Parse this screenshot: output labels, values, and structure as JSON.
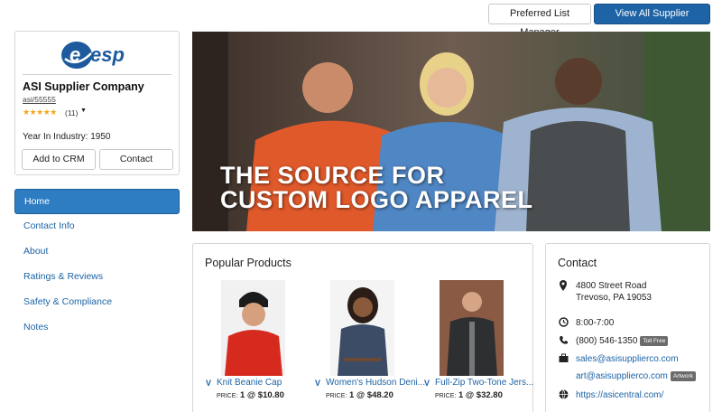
{
  "header": {
    "preferred_list_label": "Preferred List Manager",
    "view_all_label": "View All Supplier Products"
  },
  "supplier": {
    "logo_text": "esp",
    "name": "ASI Supplier Company",
    "asi_number": "asi/55555",
    "stars": "★★★★★",
    "rating_count": "(11)",
    "years_label": "Year In Industry: 1950",
    "add_crm_label": "Add to CRM",
    "contact_label": "Contact"
  },
  "nav": {
    "items": [
      {
        "label": "Home"
      },
      {
        "label": "Contact Info"
      },
      {
        "label": "About"
      },
      {
        "label": "Ratings & Reviews"
      },
      {
        "label": "Safety & Compliance"
      },
      {
        "label": "Notes"
      }
    ]
  },
  "hero": {
    "line1": "THE SOURCE FOR",
    "line2": "CUSTOM LOGO APPAREL"
  },
  "popular": {
    "title": "Popular Products",
    "products": [
      {
        "name": "Knit Beanie Cap",
        "price_label": "PRICE:",
        "price": "1 @ $10.80"
      },
      {
        "name": "Women's Hudson Deni...",
        "price_label": "PRICE:",
        "price": "1 @ $48.20"
      },
      {
        "name": "Full-Zip Two-Tone Jers...",
        "price_label": "PRICE:",
        "price": "1 @ $32.80"
      }
    ]
  },
  "contact": {
    "title": "Contact",
    "address_line1": "4800 Street Road",
    "address_line2": "Trevoso, PA 19053",
    "hours": "8:00-7:00",
    "phone": "(800) 546-1350",
    "phone_badge": "Toll Free",
    "email_sales": "sales@asisupplierco.com",
    "email_art": "art@asisupplierco.com",
    "art_badge": "Artwork",
    "website": "https://asicentral.com/"
  },
  "colors": {
    "primary": "#1d63a6",
    "nav_active": "#2e7cc2",
    "star": "#f0a81b"
  }
}
